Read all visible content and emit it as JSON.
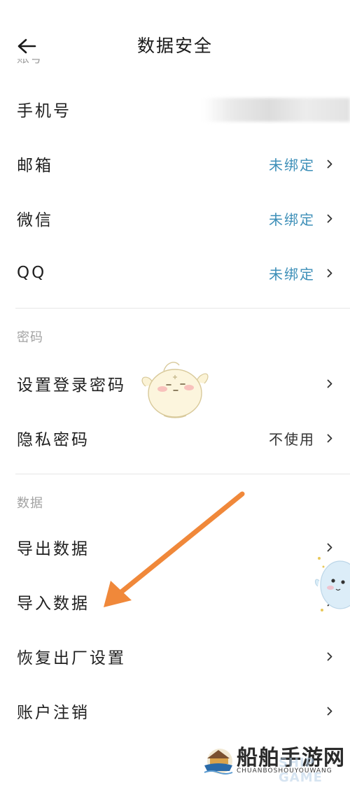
{
  "header": {
    "title": "数据安全",
    "cut_section_label": "账号"
  },
  "account": {
    "rows": [
      {
        "label": "手机号",
        "value": ""
      },
      {
        "label": "邮箱",
        "value": "未绑定"
      },
      {
        "label": "微信",
        "value": "未绑定"
      },
      {
        "label": "QQ",
        "value": "未绑定"
      }
    ]
  },
  "password": {
    "section_label": "密码",
    "rows": [
      {
        "label": "设置登录密码",
        "value": ""
      },
      {
        "label": "隐私密码",
        "value": "不使用"
      }
    ]
  },
  "data_section": {
    "section_label": "数据",
    "rows": [
      {
        "label": "导出数据"
      },
      {
        "label": "导入数据"
      },
      {
        "label": "恢复出厂设置"
      },
      {
        "label": "账户注销"
      }
    ]
  },
  "watermark": {
    "title": "船舶手游网",
    "subtitle": "CHUANBOSHOUYOUWANG",
    "overlay": "SHIP GAME"
  },
  "colors": {
    "accent_blue": "#3d8fb8",
    "annotation_arrow": "#f0883a",
    "divider": "#e6e6e6"
  },
  "icons": {
    "back": "arrow-left-icon",
    "chevron": "chevron-right-icon"
  }
}
